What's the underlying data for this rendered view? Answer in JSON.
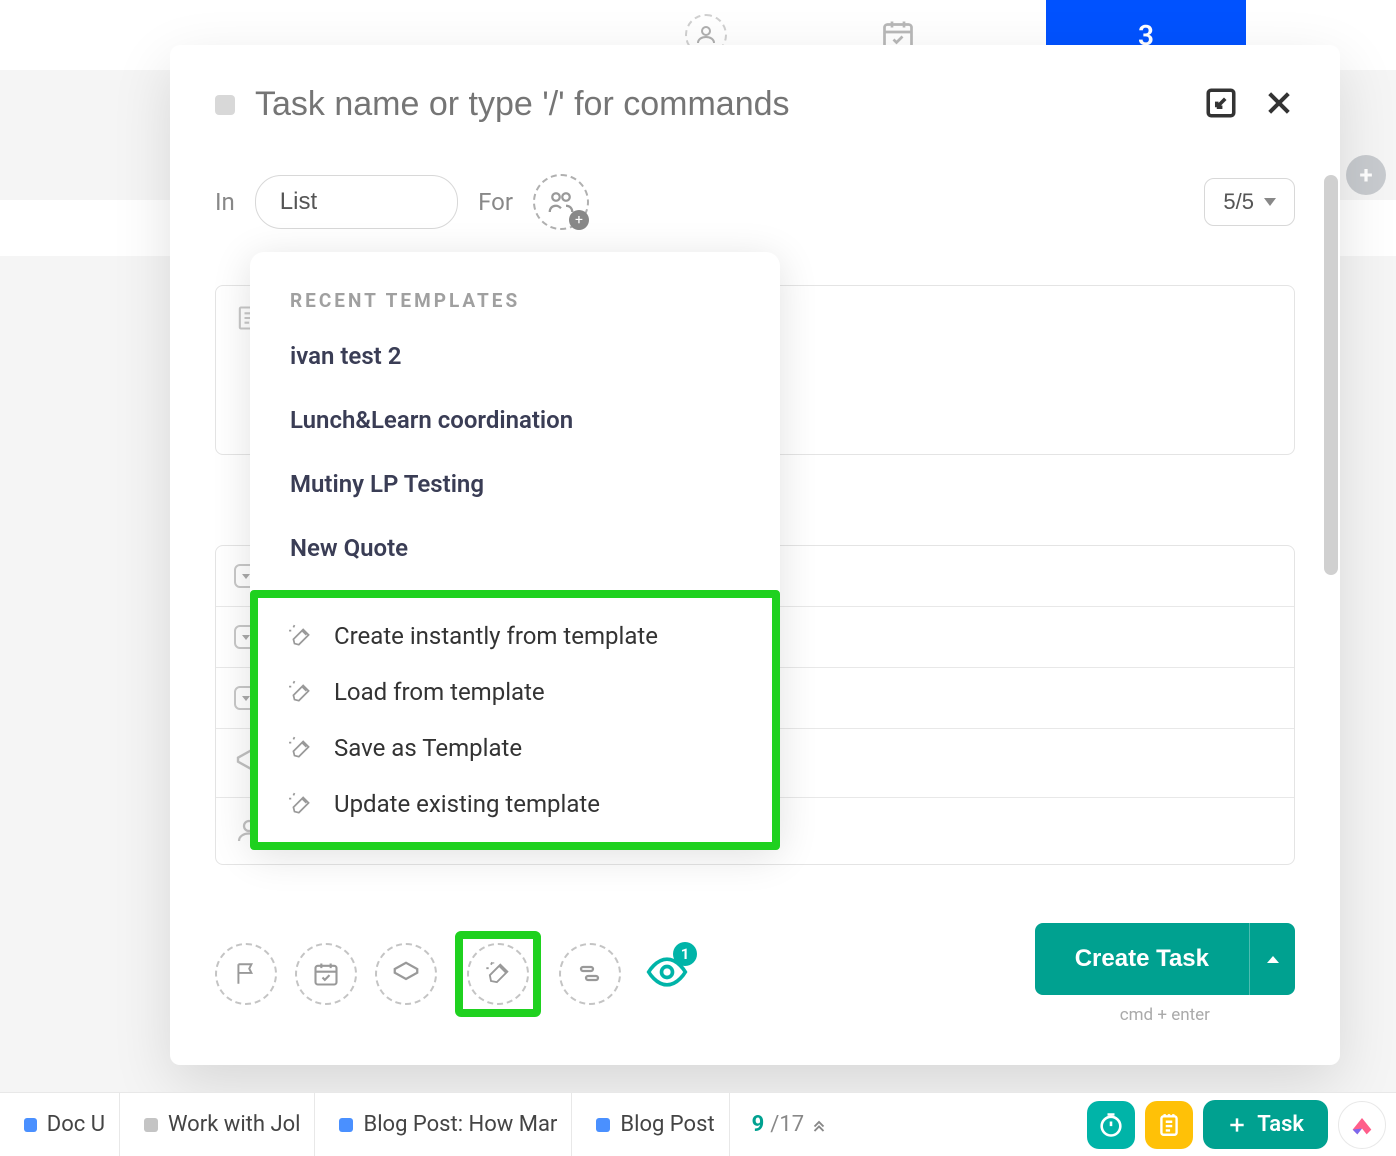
{
  "header": {
    "blue_tab": "3"
  },
  "modal": {
    "task_name_placeholder": "Task name or type '/' for commands",
    "in_label": "In",
    "list_button": "List",
    "for_label": "For",
    "count_display": "5/5"
  },
  "templates": {
    "section_title": "RECENT TEMPLATES",
    "items": [
      "ivan test 2",
      "Lunch&Learn coordination",
      "Mutiny LP Testing",
      "New Quote"
    ],
    "actions": [
      "Create instantly from template",
      "Load from template",
      "Save as Template",
      "Update existing template"
    ]
  },
  "watchers_badge": "1",
  "create": {
    "button": "Create Task",
    "shortcut": "cmd + enter"
  },
  "footer": {
    "tabs": [
      {
        "color": "blue",
        "label": "Doc U"
      },
      {
        "color": "gray",
        "label": "Work with Jol"
      },
      {
        "color": "blue",
        "label": "Blog Post: How Mar"
      },
      {
        "color": "blue",
        "label": "Blog Post"
      }
    ],
    "count_current": "9",
    "count_total": "/17",
    "task_button": "Task"
  }
}
